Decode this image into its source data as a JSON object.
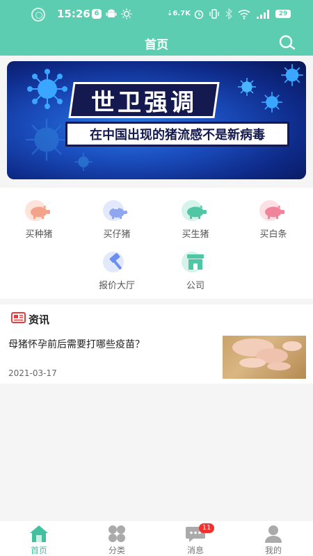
{
  "status_bar": {
    "time": "15:26",
    "notification_count": "6",
    "net_speed": "6.7K",
    "battery": "29"
  },
  "header": {
    "title": "首页"
  },
  "banner": {
    "headline": "世卫强调",
    "subline": "在中国出现的猪流感不是新病毒",
    "slide_count": 2,
    "active_slide": 1
  },
  "categories": [
    {
      "label": "买种猪",
      "icon": "pig-icon",
      "color": "#f2a38a"
    },
    {
      "label": "买仔猪",
      "icon": "piglet-icon",
      "color": "#8fa7f0"
    },
    {
      "label": "买生猪",
      "icon": "pig-icon",
      "color": "#4fc7a4"
    },
    {
      "label": "买白条",
      "icon": "pig-icon",
      "color": "#f0849a"
    },
    {
      "label": "报价大厅",
      "icon": "hammer-icon",
      "color": "#6b8ef0"
    },
    {
      "label": "公司",
      "icon": "store-icon",
      "color": "#4fc7a4"
    }
  ],
  "news": {
    "section_title": "资讯",
    "articles": [
      {
        "title": "母猪怀孕前后需要打哪些疫苗？",
        "date": "2021-03-17"
      }
    ]
  },
  "tabbar": {
    "tabs": [
      {
        "label": "首页",
        "active": true
      },
      {
        "label": "分类",
        "active": false
      },
      {
        "label": "消息",
        "active": false,
        "badge": "11"
      },
      {
        "label": "我的",
        "active": false
      }
    ]
  },
  "colors": {
    "brand": "#5ccdb0",
    "active_tab": "#43c0a0",
    "badge": "#f23030"
  }
}
